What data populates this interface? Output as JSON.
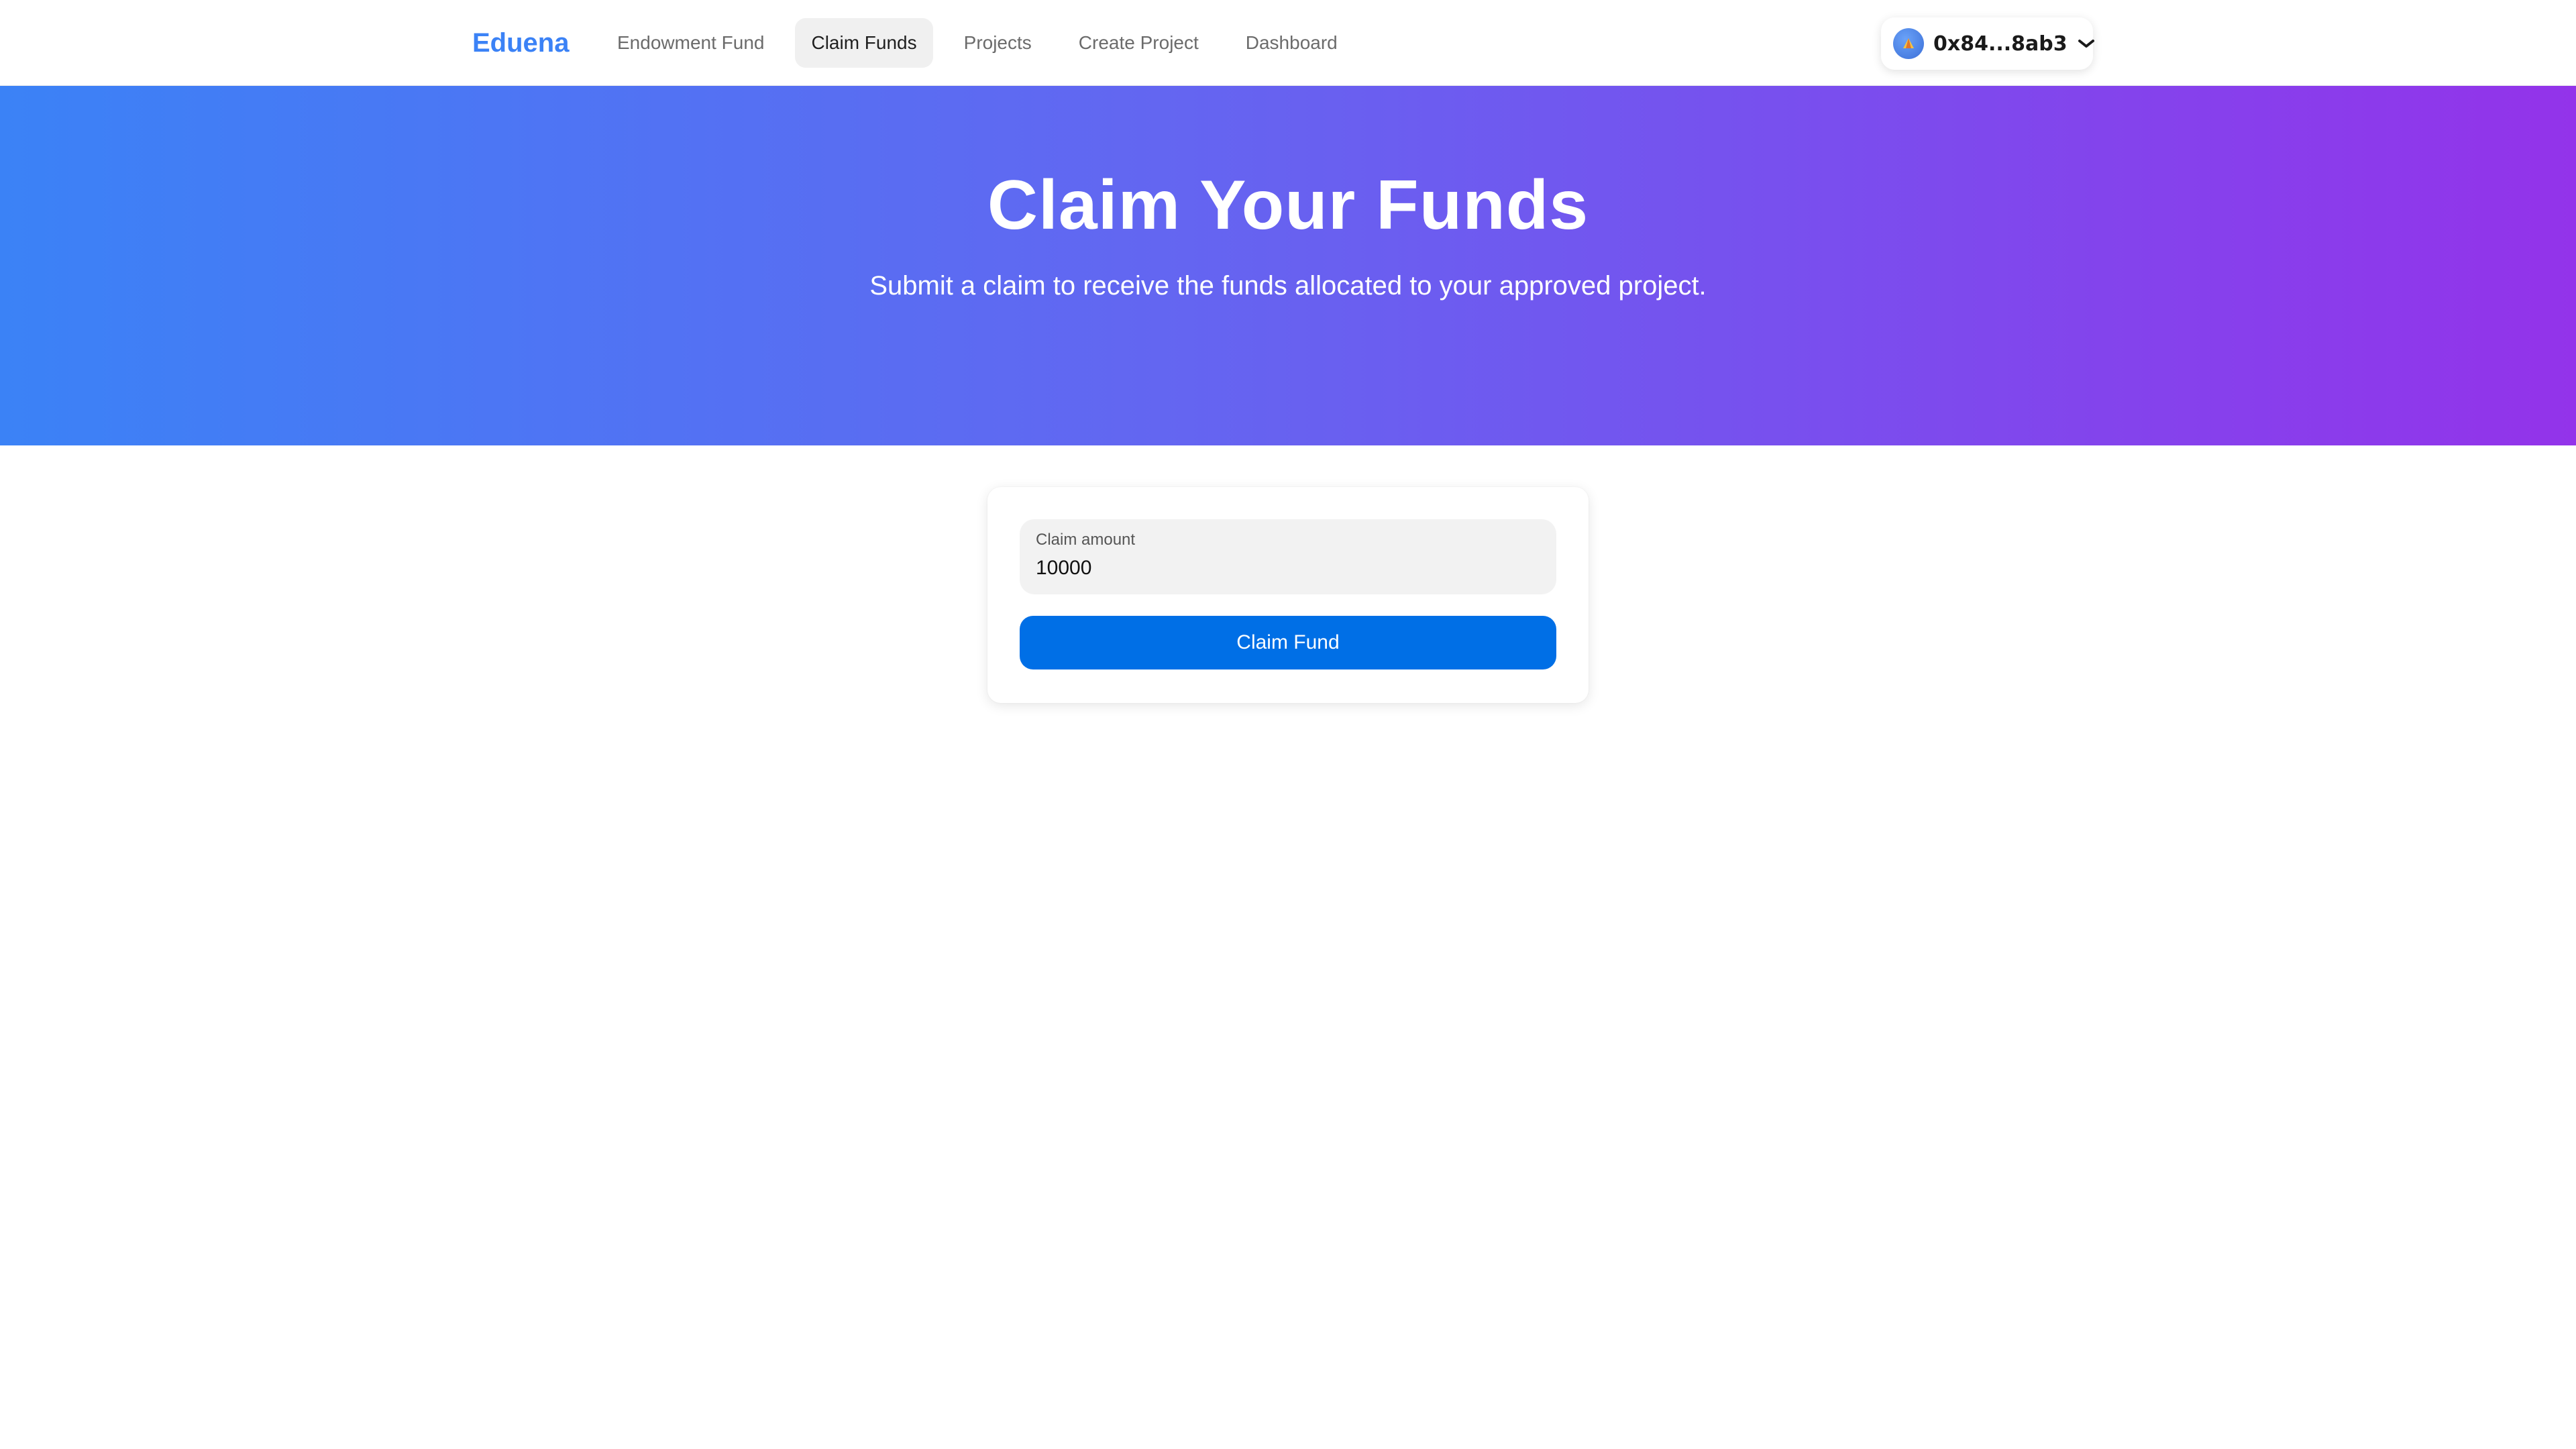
{
  "header": {
    "brand": "Eduena",
    "nav": [
      {
        "label": "Endowment Fund",
        "active": false
      },
      {
        "label": "Claim Funds",
        "active": true
      },
      {
        "label": "Projects",
        "active": false
      },
      {
        "label": "Create Project",
        "active": false
      },
      {
        "label": "Dashboard",
        "active": false
      }
    ],
    "wallet": {
      "address": "0x84...8ab3",
      "avatar_icon": "network-avatar-icon",
      "dropdown_icon": "chevron-down-icon"
    }
  },
  "hero": {
    "title": "Claim Your Funds",
    "subtitle": "Submit a claim to receive the funds allocated to your approved project.",
    "gradient": [
      "#3b82f6",
      "#6366f1",
      "#9333ea"
    ]
  },
  "claim_form": {
    "amount_label": "Claim amount",
    "amount_value": "10000",
    "submit_label": "Claim Fund"
  },
  "colors": {
    "brand": "#3b82f6",
    "primary_button": "#006fe6",
    "active_tab_bg": "#f0f0f0"
  }
}
